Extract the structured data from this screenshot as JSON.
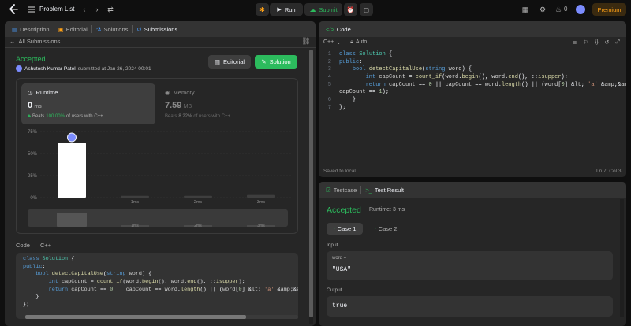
{
  "topbar": {
    "problem_list_label": "Problem List",
    "run_label": "Run",
    "submit_label": "Submit",
    "streak_count": "0",
    "premium_label": "Premium"
  },
  "left_tabs": [
    {
      "label": "Description"
    },
    {
      "label": "Editorial"
    },
    {
      "label": "Solutions"
    },
    {
      "label": "Submissions"
    }
  ],
  "submission": {
    "back_label": "All Submissions",
    "status": "Accepted",
    "user": "Ashutosh Kumar Patel",
    "submitted_text": "submitted at Jan 26, 2024 00:01",
    "editorial_btn": "Editorial",
    "solution_btn": "Solution",
    "runtime_label": "Runtime",
    "runtime_value": "0",
    "runtime_unit": "ms",
    "runtime_beats_prefix": "Beats",
    "runtime_beats_pct": "100.00%",
    "runtime_beats_suffix": "of users with C++",
    "memory_label": "Memory",
    "memory_value": "7.59",
    "memory_unit": "MB",
    "memory_beats_prefix": "Beats",
    "memory_beats_pct": "8.22%",
    "memory_beats_suffix": "of users with C++"
  },
  "chart_data": {
    "type": "bar",
    "y_ticks": [
      "75%",
      "50%",
      "25%",
      "0%"
    ],
    "ylim": [
      0,
      75
    ],
    "categories": [
      "",
      "1ms",
      "2ms",
      "3ms"
    ],
    "values": [
      62,
      2,
      2,
      3
    ],
    "highlight_index": 0,
    "brush_labels": [
      "1ms",
      "2ms",
      "3ms"
    ],
    "accent": "#ffffff"
  },
  "code_header": {
    "code_label": "Code",
    "lang": "C++"
  },
  "submitted_code": [
    "class Solution {",
    "public:",
    "    bool detectCapitalUse(string word) {",
    "        int capCount = count_if(word.begin(), word.end(), ::isupper);",
    "        return capCount == 0 || capCount == word.length() || (word[0] < 'a' && ca",
    "    }",
    "};"
  ],
  "editor": {
    "tab_label": "Code",
    "lang": "C++",
    "auto_label": "Auto",
    "lines": [
      "class Solution {",
      "public:",
      "    bool detectCapitalUse(string word) {",
      "        int capCount = count_if(word.begin(), word.end(), ::isupper);",
      "        return capCount == 0 || capCount == word.length() || (word[0] < 'a' &&",
      "capCount == 1);",
      "    }",
      "};"
    ],
    "line_numbers": [
      "1",
      "2",
      "3",
      "4",
      "5",
      "",
      "6",
      "7"
    ],
    "saved_label": "Saved to local",
    "cursor_pos": "Ln 7, Col 3"
  },
  "result": {
    "testcase_tab": "Testcase",
    "result_tab": "Test Result",
    "status": "Accepted",
    "runtime_text": "Runtime: 3 ms",
    "cases": [
      "Case 1",
      "Case 2"
    ],
    "input_label": "Input",
    "input_var": "word =",
    "input_value": "\"USA\"",
    "output_label": "Output",
    "output_value": "true"
  },
  "colors": {
    "accent_green": "#2cbb5d",
    "brand_orange": "#ffa116",
    "bg": "#0f0f0f",
    "panel": "#262626"
  }
}
